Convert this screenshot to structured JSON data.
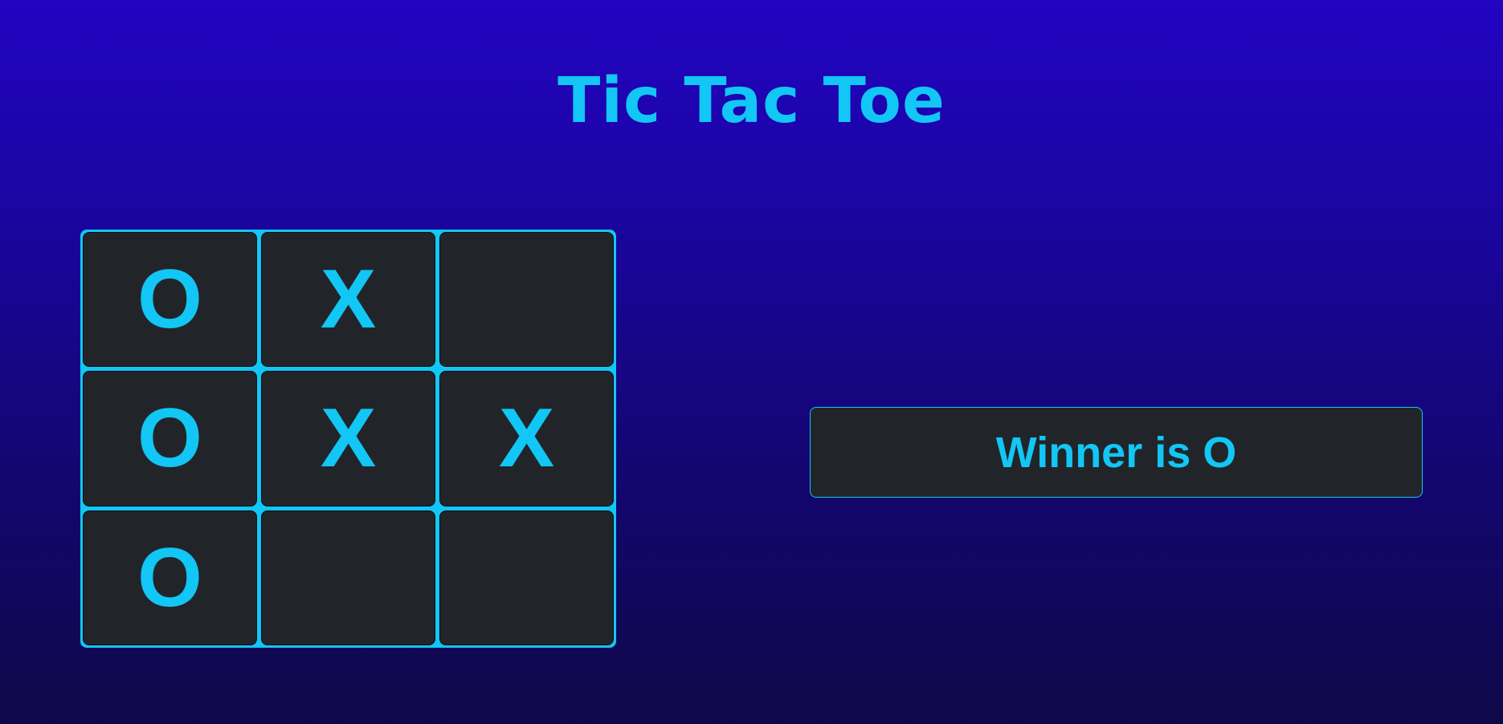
{
  "title": "Tic Tac Toe",
  "board": {
    "cells": [
      "O",
      "X",
      "",
      "O",
      "X",
      "X",
      "O",
      "",
      ""
    ]
  },
  "status": "Winner is O",
  "colors": {
    "accent": "#12c6f5",
    "cell_background": "#212529",
    "background_top": "#2204c2",
    "background_bottom": "#0f0848"
  }
}
